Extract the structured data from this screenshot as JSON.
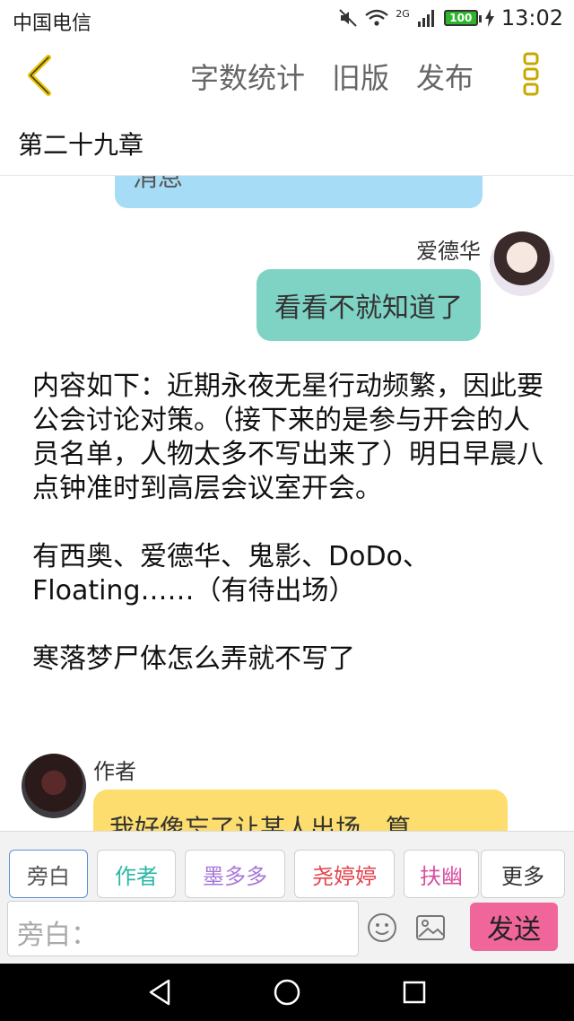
{
  "status_bar": {
    "carrier": "中国电信",
    "network": "2G",
    "battery": "100",
    "time": "13:02"
  },
  "toolbar": {
    "word_count": "字数统计",
    "old_version": "旧版",
    "publish": "发布"
  },
  "chapter_title": "第二十九章",
  "messages": {
    "partial_blue": "消息",
    "edward_name": "爱德华",
    "edward_text": "看看不就知道了",
    "narration_1": "内容如下：近期永夜无星行动频繁，因此要公会讨论对策。（接下来的是参与开会的人员名单，人物太多不写出来了）明日早晨八点钟准时到高层会议室开会。",
    "narration_2": "有西奥、爱德华、鬼影、DoDo、Floating……（有待出场）",
    "narration_3": "寒落梦尸体怎么弄就不写了",
    "author_name": "作者",
    "author_text": "我好像忘了让某人出场，算"
  },
  "chips": [
    {
      "label": "旁白",
      "color": "#555555"
    },
    {
      "label": "作者",
      "color": "#2bb7a6"
    },
    {
      "label": "墨多多",
      "color": "#a678d8"
    },
    {
      "label": "尧婷婷",
      "color": "#e2444d"
    },
    {
      "label": "扶幽",
      "color": "#d84fa0"
    },
    {
      "label": "更多",
      "color": "#333333"
    }
  ],
  "input": {
    "placeholder": "旁白：",
    "send_label": "发送"
  },
  "icons": {
    "accent": "#f2c400",
    "send_color": "#f1669a"
  }
}
